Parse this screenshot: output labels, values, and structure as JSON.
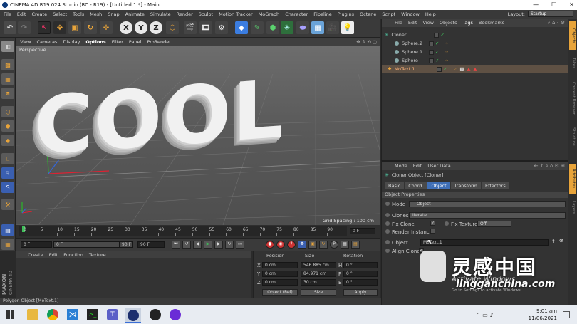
{
  "window": {
    "title": "CINEMA 4D R19.024 Studio (RC - R19) - [Untitled 1 *] - Main",
    "minimize": "—",
    "maximize": "☐",
    "close": "✕"
  },
  "menu": [
    "File",
    "Edit",
    "Create",
    "Select",
    "Tools",
    "Mesh",
    "Snap",
    "Animate",
    "Simulate",
    "Render",
    "Sculpt",
    "Motion Tracker",
    "MoGraph",
    "Character",
    "Pipeline",
    "Plugins",
    "Octane",
    "Script",
    "Window",
    "Help"
  ],
  "layout": {
    "label": "Layout:",
    "value": "Startup"
  },
  "viewport": {
    "menu": [
      "View",
      "Cameras",
      "Display",
      "Options",
      "Filter",
      "Panel",
      "ProRender"
    ],
    "label": "Perspective",
    "text3d": "COOL",
    "grid_spacing": "Grid Spacing : 100 cm"
  },
  "timeline": {
    "ticks": [
      "0",
      "5",
      "10",
      "15",
      "20",
      "25",
      "30",
      "35",
      "40",
      "45",
      "50",
      "55",
      "60",
      "65",
      "70",
      "75",
      "80",
      "85",
      "90"
    ],
    "end_frame": "0 F"
  },
  "playback": {
    "start": "0 F",
    "current": "0 F",
    "range_end": "90 F",
    "end": "90 F"
  },
  "material_manager": {
    "menu": [
      "Create",
      "Edit",
      "Function",
      "Texture"
    ],
    "brand1": "MAXON",
    "brand2": "CINEMA 4D"
  },
  "coords": {
    "headers": [
      "Position",
      "Size",
      "Rotation"
    ],
    "rows": [
      {
        "axis": "X",
        "pos": "0 cm",
        "size": "546.885 cm",
        "rot_axis": "H",
        "rot": "0 °"
      },
      {
        "axis": "Y",
        "pos": "0 cm",
        "size": "84.971 cm",
        "rot_axis": "P",
        "rot": "0 °"
      },
      {
        "axis": "Z",
        "pos": "0 cm",
        "size": "30 cm",
        "rot_axis": "B",
        "rot": "0 °"
      }
    ],
    "mode": "Object (Rel)",
    "size_mode": "Size",
    "apply": "Apply"
  },
  "object_manager": {
    "menu": [
      "File",
      "Edit",
      "View",
      "Objects",
      "Tags",
      "Bookmarks"
    ],
    "objects": [
      {
        "name": "Cloner",
        "indent": 0
      },
      {
        "name": "Sphere.2",
        "indent": 1
      },
      {
        "name": "Sphere.1",
        "indent": 1
      },
      {
        "name": "Sphere",
        "indent": 1
      },
      {
        "name": "MoText.1",
        "indent": 0
      }
    ]
  },
  "attributes": {
    "menu": [
      "Mode",
      "Edit",
      "User Data"
    ],
    "title": "Cloner Object [Cloner]",
    "tabs": [
      "Basic",
      "Coord.",
      "Object",
      "Transform",
      "Effectors"
    ],
    "active_tab": "Object",
    "section": "Object Properties",
    "mode_label": "Mode",
    "mode_value": "Object",
    "clones_label": "Clones",
    "clones_value": "Iterate",
    "fix_clone": "Fix Clone",
    "fix_texture": "Fix Texture",
    "fix_texture_value": "Off",
    "render_instances": "Render Instances",
    "object_label": "Object",
    "object_value": "MoText.1",
    "align_clone": "Align Clone"
  },
  "right_tabs": [
    "Objects",
    "Takes",
    "Content Browser",
    "Structure",
    "Attributes",
    "Layers"
  ],
  "status": "Polygon Object [MoText.1]",
  "taskbar": {
    "time": "9:01 am",
    "date": "11/06/2021"
  },
  "watermark": {
    "cn": "灵感中国",
    "url": "lingganchina.com",
    "win1": "Activate Windows",
    "win2": "Go to Settings to activate Windows."
  }
}
